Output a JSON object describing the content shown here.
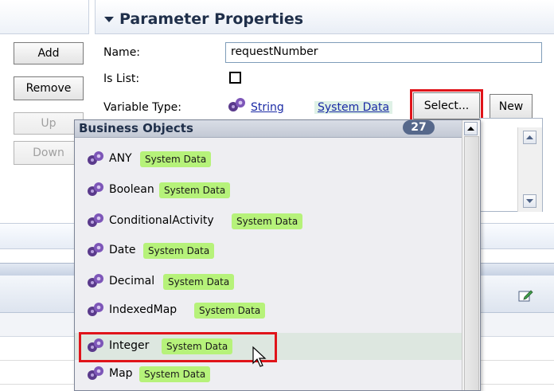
{
  "header": {
    "title": "Parameter Properties"
  },
  "buttons": {
    "add": "Add",
    "remove": "Remove",
    "up": "Up",
    "down": "Down",
    "select": "Select...",
    "new": "New"
  },
  "form": {
    "name_label": "Name:",
    "name_value": "requestNumber",
    "is_list_label": "Is List:",
    "is_list_checked": false,
    "variable_type_label": "Variable Type:",
    "variable_type_value": "String",
    "variable_type_source": "System Data"
  },
  "popup": {
    "title": "Business Objects",
    "count": "27",
    "items": [
      {
        "name": "ANY",
        "tag": "System Data"
      },
      {
        "name": "Boolean",
        "tag": "System Data"
      },
      {
        "name": "ConditionalActivity",
        "tag": "System Data"
      },
      {
        "name": "Date",
        "tag": "System Data"
      },
      {
        "name": "Decimal",
        "tag": "System Data"
      },
      {
        "name": "IndexedMap",
        "tag": "System Data"
      },
      {
        "name": "Integer",
        "tag": "System Data"
      },
      {
        "name": "Map",
        "tag": "System Data"
      }
    ],
    "highlighted_item": "Integer"
  },
  "icons": {
    "business_object": "business-object-icon",
    "edit": "edit-icon",
    "cursor": "mouse-pointer-icon"
  },
  "colors": {
    "highlight_red": "#e0141a",
    "tag_green": "#b6f27a",
    "link_blue": "#1a2aa5"
  }
}
